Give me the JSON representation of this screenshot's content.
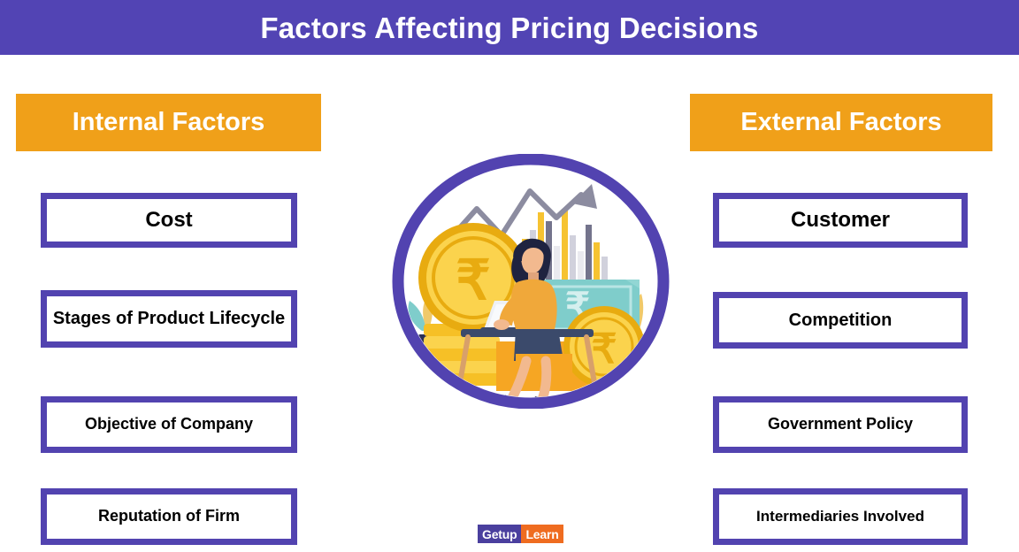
{
  "header": {
    "title": "Factors Affecting Pricing Decisions",
    "background_color": "#5244b4",
    "text_color": "#ffffff"
  },
  "columns": {
    "accent_color": "#f0a019",
    "box_border_color": "#5243b0",
    "left": {
      "heading": "Internal Factors",
      "items": [
        {
          "label": "Cost",
          "size": "lg"
        },
        {
          "label": "Stages of Product Lifecycle",
          "size": "md"
        },
        {
          "label": "Objective of Company",
          "size": "sm"
        },
        {
          "label": "Reputation of Firm",
          "size": "sm"
        }
      ]
    },
    "right": {
      "heading": "External Factors",
      "items": [
        {
          "label": "Customer",
          "size": "lg"
        },
        {
          "label": "Competition",
          "size": "md"
        },
        {
          "label": "Government Policy",
          "size": "sm"
        },
        {
          "label": "Intermediaries Involved",
          "size": "xs"
        }
      ]
    }
  },
  "illustration": {
    "name": "business-pricing-illustration",
    "description": "Woman working on laptop at desk with rupee coins, rupee banknote, rising growth chart and plants inside a purple circle",
    "ring_color": "#5243b0",
    "coin_color": "#f6c026",
    "note_color": "#7fcdcb",
    "currency_symbol": "₹"
  },
  "logo": {
    "part1": "Getup",
    "part2": "Learn",
    "part1_color": "#4a3f9e",
    "part2_color": "#ef6c20"
  }
}
